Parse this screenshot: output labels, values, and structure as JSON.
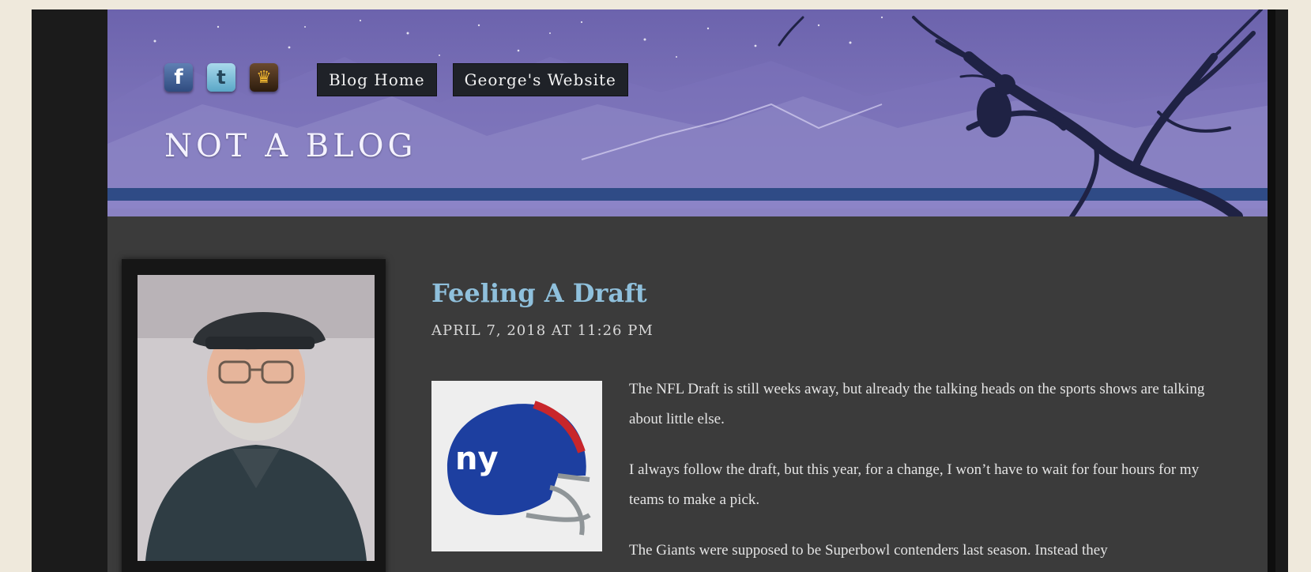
{
  "header": {
    "site_title": "NOT A BLOG",
    "nav": [
      "Blog Home",
      "George's Website"
    ],
    "social_icons": [
      "facebook-icon",
      "twitter-icon",
      "crown-icon"
    ]
  },
  "post": {
    "title": "Feeling A Draft",
    "date": "APRIL 7, 2018 AT 11:26 PM",
    "paragraphs": [
      "The NFL Draft is still weeks away, but already the talking heads on the sports shows are talking about little else.",
      "I always follow the draft, but this year, for a change, I won’t have to wait for four hours for my teams to make a pick.",
      "The Giants were supposed to be Superbowl contenders last season.  Instead they"
    ],
    "thumbnail_text": "ny"
  },
  "colors": {
    "page_background": "#efe9dc",
    "header_sky": "#7a6fb8",
    "title_link": "#8fc0dc",
    "content_background": "#3b3b3b"
  }
}
